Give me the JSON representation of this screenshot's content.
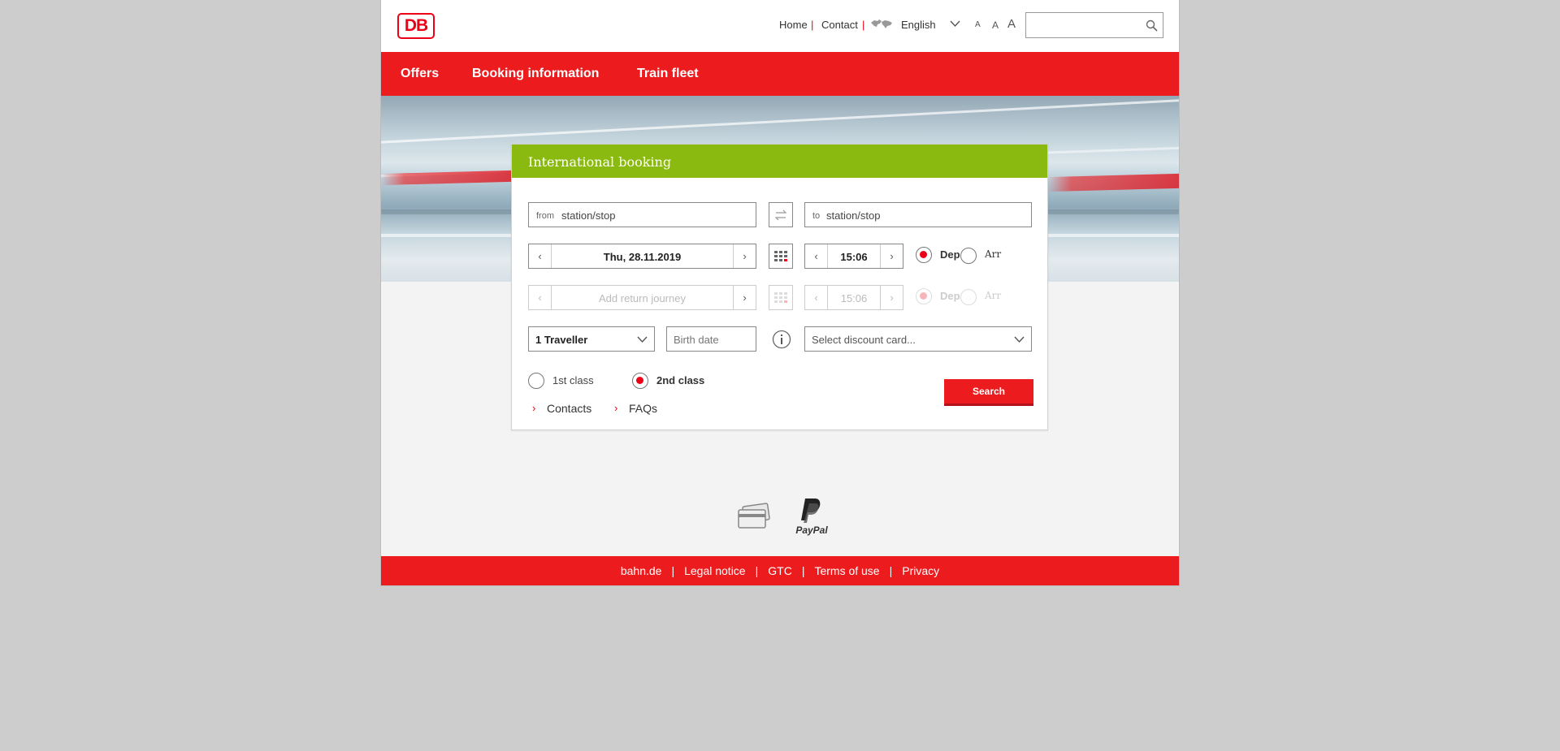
{
  "header": {
    "logo_text": "DB",
    "links": {
      "home": "Home",
      "contact": "Contact"
    },
    "separator": "|",
    "language": "English",
    "font_sizes": [
      "A",
      "A",
      "A"
    ],
    "search_placeholder": ""
  },
  "nav": {
    "items": [
      "Offers",
      "Booking information",
      "Train fleet"
    ]
  },
  "booking": {
    "title": "International booking",
    "from": {
      "prefix": "from",
      "placeholder": "station/stop"
    },
    "to": {
      "prefix": "to",
      "placeholder": "station/stop"
    },
    "outbound": {
      "date": "Thu, 28.11.2019",
      "time": "15:06",
      "dep_label": "Dep",
      "arr_label": "Arr",
      "selected": "Dep"
    },
    "return": {
      "date_placeholder": "Add return journey",
      "time": "15:06",
      "dep_label": "Dep",
      "arr_label": "Arr"
    },
    "travellers": "1 Traveller",
    "birth_date_placeholder": "Birth date",
    "discount_placeholder": "Select discount card...",
    "class_options": [
      "1st class",
      "2nd class"
    ],
    "class_selected": "2nd class",
    "search_label": "Search",
    "links": [
      "Contacts",
      "FAQs"
    ]
  },
  "payment": {
    "paypal_label": "PayPal"
  },
  "footer": {
    "links": [
      "bahn.de",
      "Legal notice",
      "GTC",
      "Terms of use",
      "Privacy"
    ],
    "separator": "|"
  },
  "colors": {
    "brand_red": "#ec1b1e",
    "booking_green": "#8aba10",
    "page_bg": "#cdcdcd"
  }
}
